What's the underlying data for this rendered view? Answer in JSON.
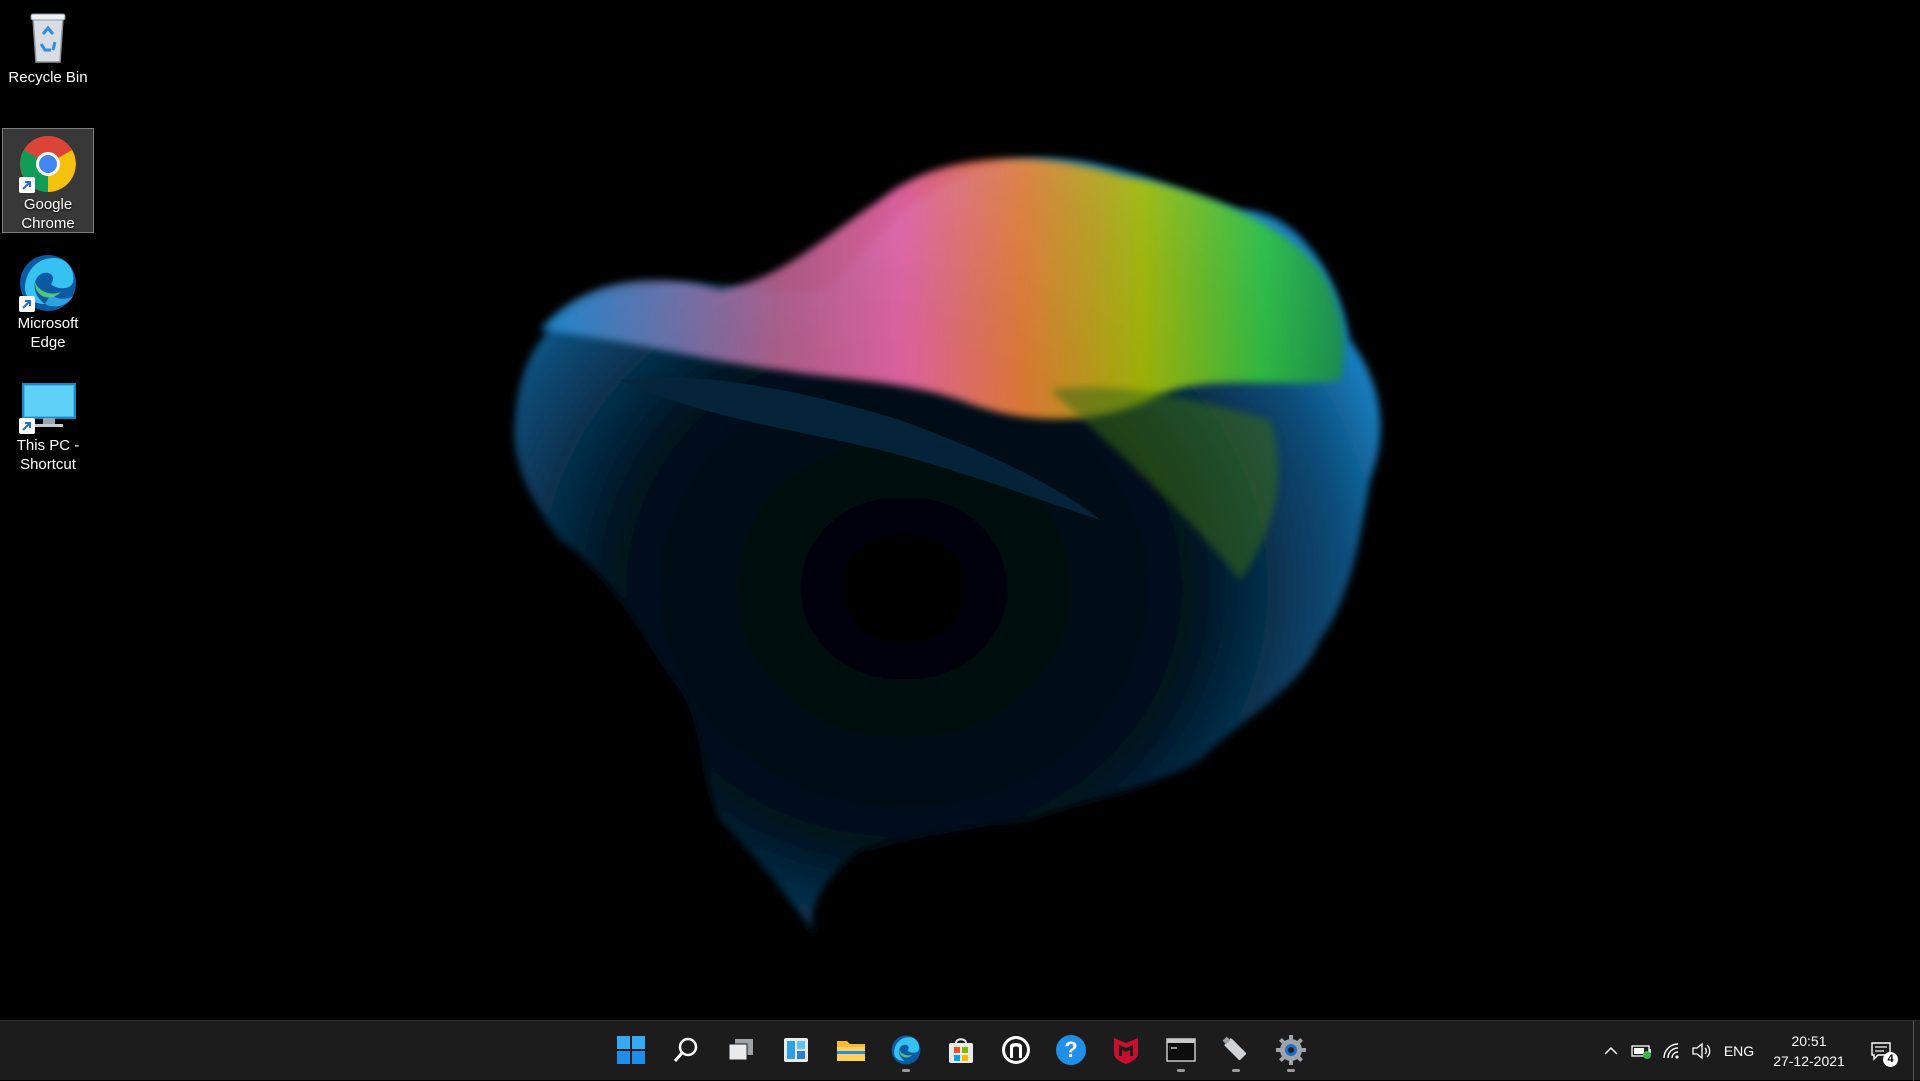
{
  "desktop": {
    "icons": [
      {
        "label": "Recycle Bin",
        "icon": "recycle-bin-icon"
      },
      {
        "label": "Google Chrome",
        "icon": "chrome-icon",
        "shortcut": true,
        "selected": true
      },
      {
        "label": "Microsoft Edge",
        "icon": "edge-icon",
        "shortcut": true
      },
      {
        "label": "This PC - Shortcut",
        "icon": "monitor-icon",
        "shortcut": true
      }
    ]
  },
  "taskbar": {
    "pinned": [
      {
        "name": "start-button",
        "icon": "windows-logo-icon"
      },
      {
        "name": "search-button",
        "icon": "search-icon"
      },
      {
        "name": "task-view-button",
        "icon": "task-view-icon"
      },
      {
        "name": "widgets-button",
        "icon": "widgets-icon"
      },
      {
        "name": "file-explorer-button",
        "icon": "folder-icon"
      },
      {
        "name": "edge-button",
        "icon": "edge-icon",
        "running": true
      },
      {
        "name": "store-button",
        "icon": "store-icon"
      },
      {
        "name": "app-button",
        "icon": "shield-outline-icon"
      },
      {
        "name": "help-button",
        "icon": "help-icon"
      },
      {
        "name": "mcafee-button",
        "icon": "mcafee-icon"
      },
      {
        "name": "terminal-button",
        "icon": "terminal-icon",
        "running": true
      },
      {
        "name": "usb-drive-button",
        "icon": "usb-icon",
        "running": true
      },
      {
        "name": "settings-button",
        "icon": "gear-icon",
        "running": true
      }
    ],
    "tray": {
      "language": "ENG",
      "time": "20:51",
      "date": "27-12-2021",
      "notification_count": "4"
    }
  },
  "colors": {
    "taskbar_bg": "#1c1c1c",
    "accent_blue": "#1e90ff"
  }
}
